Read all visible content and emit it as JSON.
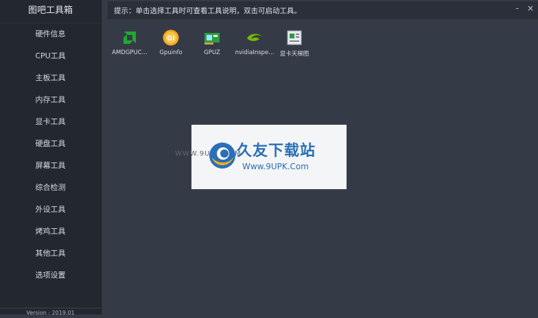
{
  "app": {
    "title": "图吧工具箱",
    "version": "Version : 2019.01"
  },
  "sidebar": {
    "items": [
      {
        "label": "硬件信息"
      },
      {
        "label": "CPU工具"
      },
      {
        "label": "主板工具"
      },
      {
        "label": "内存工具"
      },
      {
        "label": "显卡工具"
      },
      {
        "label": "硬盘工具"
      },
      {
        "label": "屏幕工具"
      },
      {
        "label": "综合检测"
      },
      {
        "label": "外设工具"
      },
      {
        "label": "烤鸡工具"
      },
      {
        "label": "其他工具"
      },
      {
        "label": "选项设置"
      }
    ]
  },
  "topbar": {
    "hint": "提示：单击选择工具时可查看工具说明，双击可启动工具。",
    "min_glyph": "-",
    "close_glyph": "×"
  },
  "tools": [
    {
      "label": "AMDGPUC...",
      "icon": "amd-icon"
    },
    {
      "label": "Gpuinfo",
      "icon": "gpuinfo-icon",
      "icon_text": "GI"
    },
    {
      "label": "GPUZ",
      "icon": "gpuz-icon"
    },
    {
      "label": "nvidiaInspe...",
      "icon": "nvidia-icon"
    },
    {
      "label": "显卡天梯图",
      "icon": "gpu-ladder-icon"
    }
  ],
  "watermark": {
    "name": "久友下载站",
    "url": "Www.9UPK.Com",
    "ghost_url": "WWW.9UPK.COM"
  },
  "colors": {
    "sidebar_bg": "#23272f",
    "main_bg": "#353b46",
    "accent": "#2a6fb7",
    "amd_green": "#1faa32",
    "nvidia_green": "#76b900"
  }
}
